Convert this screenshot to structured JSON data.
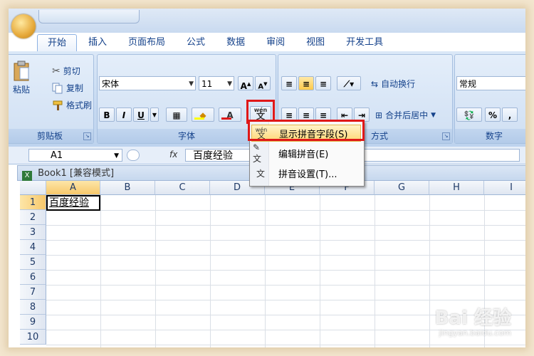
{
  "tabs": [
    "开始",
    "插入",
    "页面布局",
    "公式",
    "数据",
    "审阅",
    "视图",
    "开发工具"
  ],
  "active_tab": "开始",
  "clipboard": {
    "paste_label": "粘贴",
    "cut_label": "剪切",
    "copy_label": "复制",
    "format_painter_label": "格式刷",
    "group_label": "剪贴板"
  },
  "font": {
    "name": "宋体",
    "size": "11",
    "bold": "B",
    "italic": "I",
    "underline": "U",
    "font_color_label": "A",
    "group_label": "字体",
    "phonetic_label": "wén",
    "phonetic_char": "文"
  },
  "alignment": {
    "wrap_text_label": "自动换行",
    "merge_center_label": "合并后居中",
    "group_label_partial": "方式"
  },
  "number": {
    "format": "常规",
    "percent": "%",
    "comma": ",",
    "group_label": "数字"
  },
  "formula_bar": {
    "name_box": "A1",
    "fx": "fx",
    "content": "百度经验"
  },
  "workbook": {
    "title": "Book1  [兼容模式]"
  },
  "sheet": {
    "columns": [
      "A",
      "B",
      "C",
      "D",
      "E",
      "F",
      "G",
      "H",
      "I"
    ],
    "rows": [
      "1",
      "2",
      "3",
      "4",
      "5",
      "6",
      "7",
      "8",
      "9",
      "10"
    ],
    "a1_value": "百度经验"
  },
  "phonetic_menu": {
    "items": [
      {
        "label": "显示拼音字段(S)",
        "highlighted": true
      },
      {
        "label": "编辑拼音(E)",
        "highlighted": false
      },
      {
        "label": "拼音设置(T)...",
        "highlighted": false
      }
    ]
  },
  "watermark": {
    "brand": "Bai 经验",
    "url": "jingyan.baidu.com"
  },
  "colors": {
    "ribbon": "#c6d9f1",
    "highlight_box": "#e01818",
    "menu_hover": "#ffd776"
  }
}
